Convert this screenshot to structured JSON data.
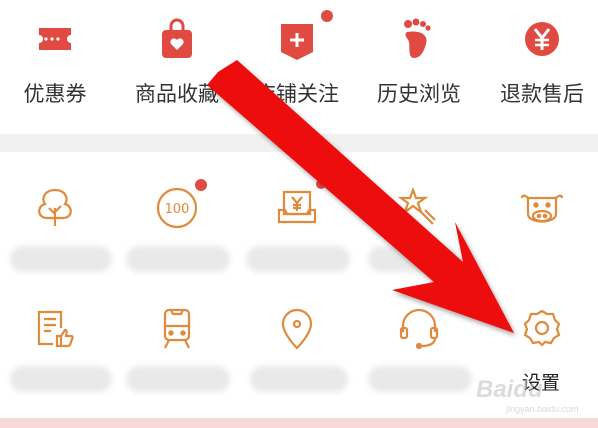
{
  "top_menu": {
    "items": [
      {
        "label": "优惠券",
        "icon": "coupon-icon"
      },
      {
        "label": "商品收藏",
        "icon": "favorites-bag-icon"
      },
      {
        "label": "店铺关注",
        "icon": "shop-follow-icon"
      },
      {
        "label": "历史浏览",
        "icon": "footprint-icon"
      },
      {
        "label": "退款售后",
        "icon": "refund-yen-icon"
      }
    ]
  },
  "grid": {
    "row1_icons": [
      "tree-icon",
      "badge-100-icon",
      "yen-tray-icon",
      "star-wand-icon",
      "cow-face-icon"
    ],
    "row2_icons": [
      "document-thumb-icon",
      "train-icon",
      "location-pin-icon",
      "headset-icon",
      "gear-icon"
    ],
    "settings_label": "设置"
  },
  "watermark": {
    "text": "Baidu",
    "sub": "jingyan.baidu.com"
  },
  "colors": {
    "accent": "#e04a40",
    "icon_orange": "#e08a3c",
    "arrow_red": "#ee0a0a"
  }
}
